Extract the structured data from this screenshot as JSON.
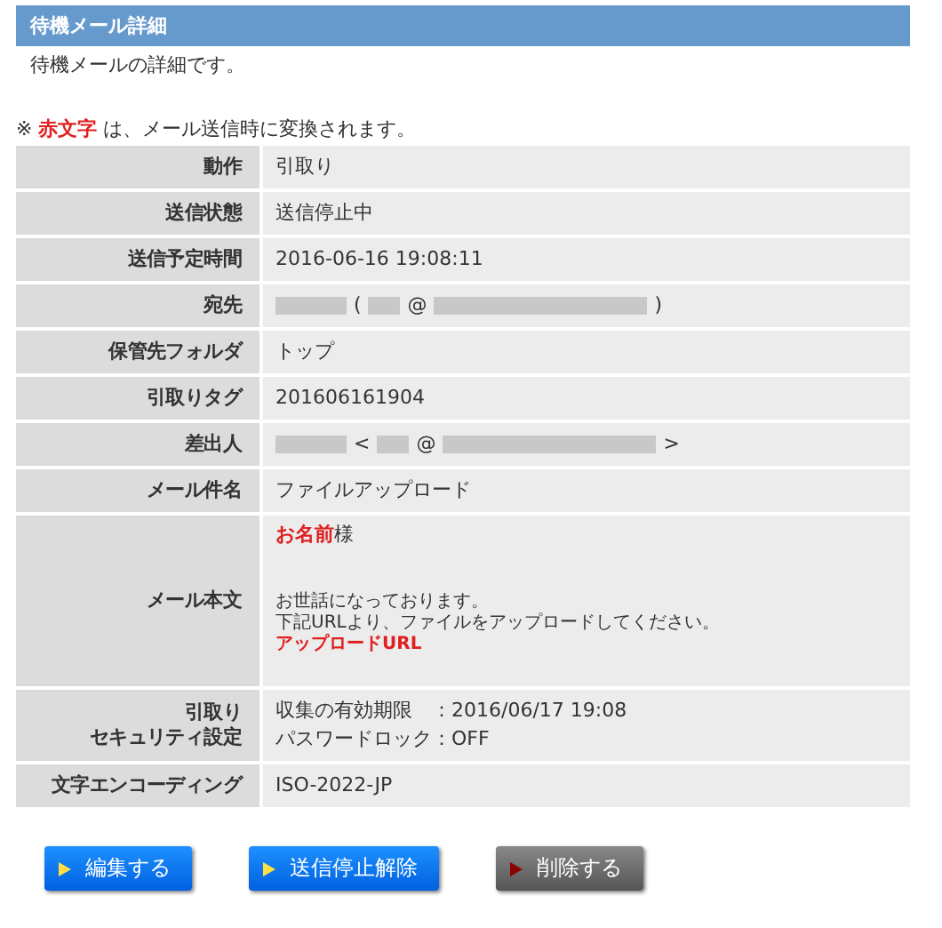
{
  "panel": {
    "title": "待機メール詳細",
    "description": "待機メールの詳細です。"
  },
  "note": "※ **赤文字** は、メール送信時に変換されます。",
  "rows": [
    {
      "label": [
        "動作"
      ],
      "value": [
        {
          "kind": "text",
          "text": "引取り"
        }
      ]
    },
    {
      "label": [
        "送信状態"
      ],
      "value": [
        {
          "kind": "text",
          "text": "送信停止中"
        }
      ]
    },
    {
      "label": [
        "送信予定時間"
      ],
      "value": [
        {
          "kind": "text",
          "text": "2016-06-16 19:08:11"
        }
      ]
    },
    {
      "label": [
        "宛先"
      ],
      "value": [
        {
          "kind": "redacted"
        },
        {
          "kind": "text",
          "text": "("
        },
        {
          "kind": "redacted"
        },
        {
          "kind": "text",
          "text": "@"
        },
        {
          "kind": "redacted"
        },
        {
          "kind": "text",
          "text": ")"
        }
      ]
    },
    {
      "label": [
        "保管先フォルダ"
      ],
      "value": [
        {
          "kind": "text",
          "text": "トップ"
        }
      ]
    },
    {
      "label": [
        "引取りタグ"
      ],
      "value": [
        {
          "kind": "text",
          "text": "201606161904"
        }
      ]
    },
    {
      "label": [
        "差出人"
      ],
      "value": [
        {
          "kind": "redacted"
        },
        {
          "kind": "text",
          "text": "<"
        },
        {
          "kind": "redacted"
        },
        {
          "kind": "text",
          "text": "@"
        },
        {
          "kind": "redacted"
        },
        {
          "kind": "text",
          "text": ">"
        }
      ]
    },
    {
      "label": [
        "メール件名"
      ],
      "value": [
        {
          "kind": "text",
          "text": "ファイルアップロード"
        }
      ]
    },
    {
      "label": [
        "メール本文"
      ],
      "value": [
        {
          "kind": "body",
          "greeting": "**お名前**様",
          "lines": [
            "お世話になっております。",
            "下記URLより、ファイルをアップロードしてください。",
            "**アップロードURL**"
          ]
        }
      ]
    },
    {
      "label": [
        "引取り",
        "セキュリティ設定"
      ],
      "value": [
        {
          "kind": "text",
          "text": "収集の有効期限　：2016/06/17 19:08"
        },
        {
          "kind": "text",
          "text": "パスワードロック：OFF"
        }
      ]
    },
    {
      "label": [
        "文字エンコーディング"
      ],
      "value": [
        {
          "kind": "text",
          "text": "ISO-2022-JP"
        }
      ]
    }
  ],
  "buttons": [
    {
      "label": "編集する",
      "kind": "primary"
    },
    {
      "label": "送信停止解除",
      "kind": "primary"
    },
    {
      "label": "削除する",
      "kind": "danger"
    }
  ]
}
